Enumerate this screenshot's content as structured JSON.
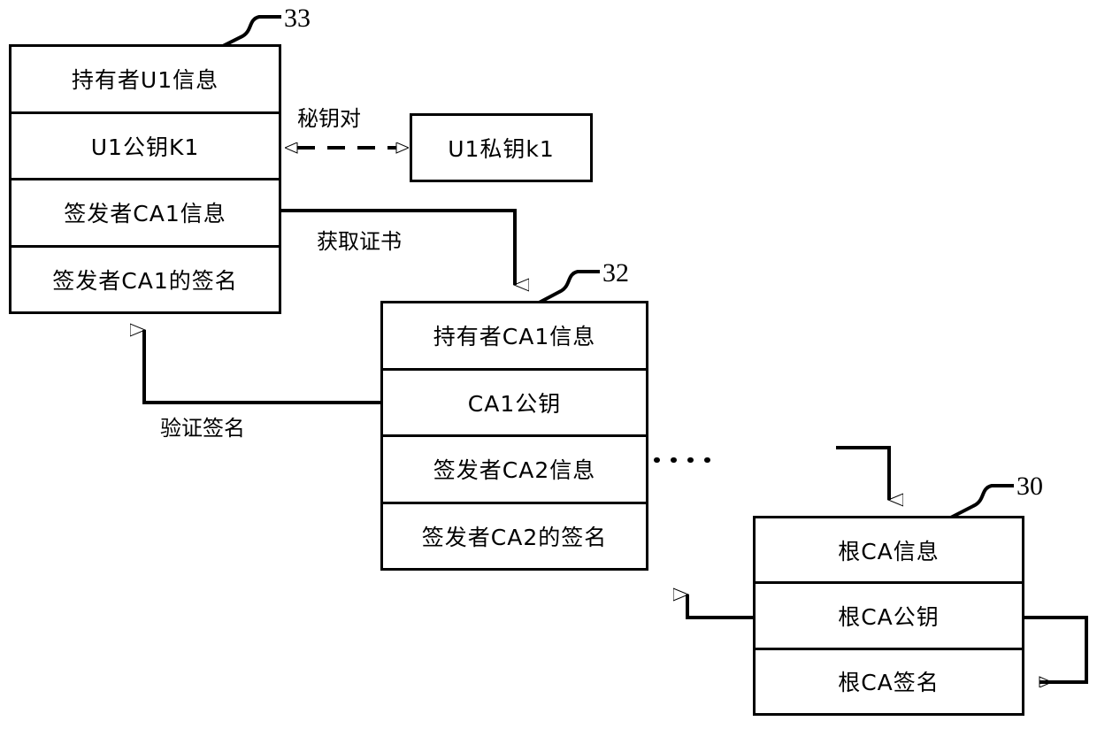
{
  "figure": {
    "type": "certificate-chain-diagram",
    "background_color": "#ffffff",
    "line_color": "#000000"
  },
  "boxes": {
    "user_cert": {
      "ref": "33",
      "rows": [
        "持有者U1信息",
        "U1公钥K1",
        "签发者CA1信息",
        "签发者CA1的签名"
      ]
    },
    "ca1_cert": {
      "ref": "32",
      "rows": [
        "持有者CA1信息",
        "CA1公钥",
        "签发者CA2信息",
        "签发者CA2的签名"
      ]
    },
    "root_cert": {
      "ref": "30",
      "rows": [
        "根CA信息",
        "根CA公钥",
        "根CA签名"
      ]
    },
    "private_key": {
      "label": "U1私钥k1"
    }
  },
  "edges": {
    "key_pair": "秘钥对",
    "get_certificate": "获取证书",
    "verify_signature": "验证签名",
    "continuation": "……"
  }
}
